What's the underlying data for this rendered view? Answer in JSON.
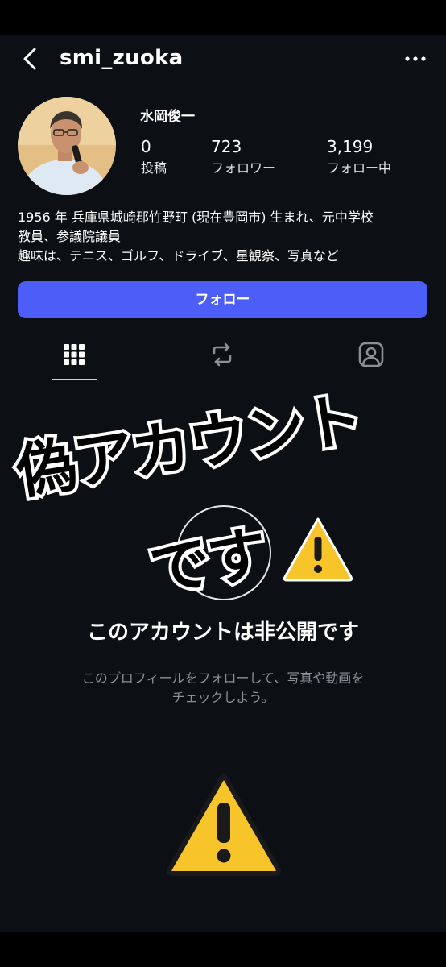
{
  "header": {
    "username": "smi_zuoka"
  },
  "profile": {
    "display_name": "水岡俊一",
    "stats": {
      "posts_count": "0",
      "posts_label": "投稿",
      "followers_count": "723",
      "followers_label": "フォロワー",
      "following_count": "3,199",
      "following_label": "フォロー中"
    },
    "bio_lines": [
      "1956 年 兵庫県城崎郡竹野町 (現在豊岡市) 生まれ、元中学校",
      "教員、参議院議員",
      "趣味は、テニス、ゴルフ、ドライブ、星観察、写真など"
    ]
  },
  "actions": {
    "follow_label": "フォロー"
  },
  "tabs": [
    {
      "name": "grid",
      "icon": "grid-icon",
      "selected": true
    },
    {
      "name": "reposts",
      "icon": "repost-icon",
      "selected": false
    },
    {
      "name": "tagged",
      "icon": "tagged-person-icon",
      "selected": false
    }
  ],
  "private_notice": {
    "title": "このアカウントは非公開です",
    "description_line1": "このプロフィールをフォローして、写真や動画を",
    "description_line2": "チェックしよう。"
  },
  "overlay": {
    "line1": "偽アカウント",
    "line2": "です"
  },
  "colors": {
    "background": "#0c0f14",
    "follow_button": "#4c5ef7",
    "warning_yellow": "#f7c42a"
  }
}
